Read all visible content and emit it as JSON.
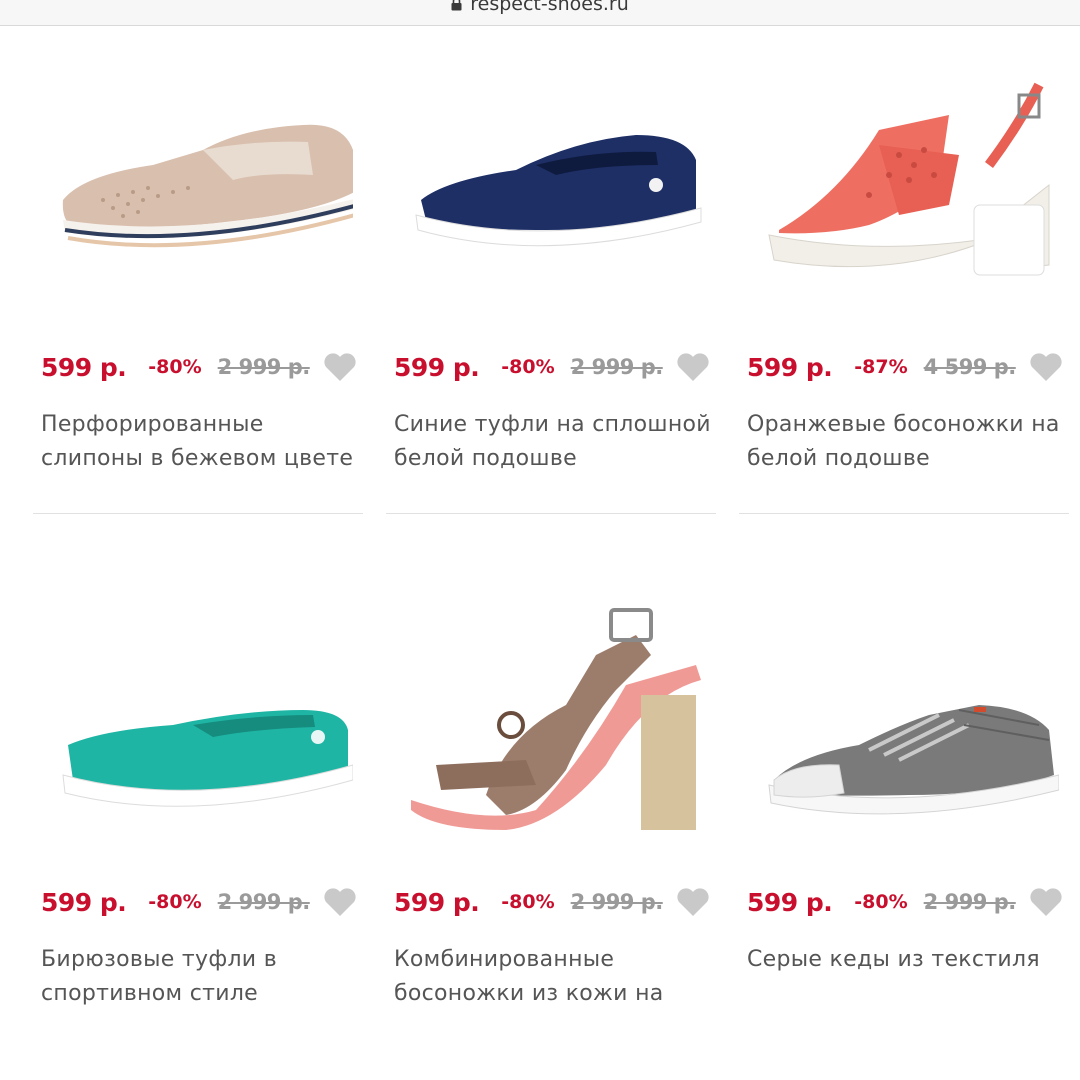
{
  "browser": {
    "url": "respect-shoes.ru"
  },
  "products": [
    {
      "price": "599 р.",
      "discount": "-80%",
      "old_price": "2 999 р.",
      "name": "Перфорированные слипоны в бежевом цвете",
      "image": "beige-perforated-slip-on"
    },
    {
      "price": "599 р.",
      "discount": "-80%",
      "old_price": "2 999 р.",
      "name": "Синие туфли на сплошной белой подошве",
      "image": "navy-flat-shoe"
    },
    {
      "price": "599 р.",
      "discount": "-87%",
      "old_price": "4 599 р.",
      "name": "Оранжевые босоножки на белой подошве",
      "image": "coral-sandal"
    },
    {
      "price": "599 р.",
      "discount": "-80%",
      "old_price": "2 999 р.",
      "name": "Бирюзовые туфли в спортивном стиле",
      "image": "turquoise-flat-shoe"
    },
    {
      "price": "599 р.",
      "discount": "-80%",
      "old_price": "2 999 р.",
      "name": "Комбинированные босоножки из кожи на уст...",
      "image": "heeled-sandal"
    },
    {
      "price": "599 р.",
      "discount": "-80%",
      "old_price": "2 999 р.",
      "name": "Серые кеды из текстиля",
      "image": "grey-sneaker"
    }
  ],
  "colors": {
    "accent": "#c8102e",
    "old_price": "#9a9a9a",
    "heart": "#c9c9c9",
    "text": "#555555"
  }
}
